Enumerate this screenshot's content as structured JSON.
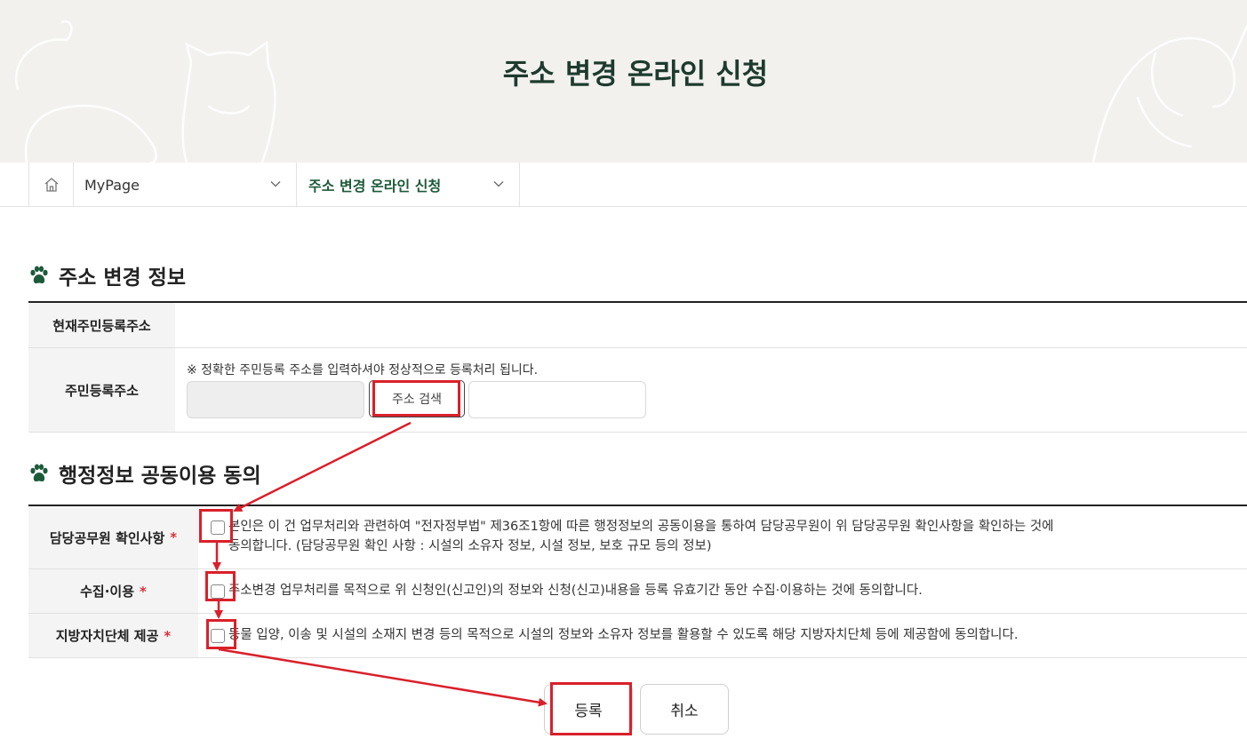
{
  "header": {
    "title": "주소 변경 온라인 신청"
  },
  "breadcrumb": {
    "home_icon": "home-icon",
    "level1": "MyPage",
    "level2": "주소 변경 온라인 신청"
  },
  "address_section": {
    "title": "주소 변경 정보",
    "current_label": "현재주민등록주소",
    "current_value": "",
    "registered_label": "주민등록주소",
    "notice": "※ 정확한 주민등록 주소를 입력하셔야 정상적으로 등록처리 됩니다.",
    "zip_value": "",
    "search_button": "주소 검색",
    "detail_value": ""
  },
  "consent_section": {
    "title": "행정정보 공동이용 동의",
    "items": [
      {
        "label": "담당공무원 확인사항",
        "required": "*",
        "text1": "본인은 이 건 업무처리와 관련하여 \"전자정부법\" 제36조1항에 따른 행정정보의 공동이용을 통하여 담당공무원이 위 담당공무원 확인사항을 확인하는 것에",
        "text2": "동의합니다. (담당공무원 확인 사항 : 시설의 소유자 정보, 시설 정보, 보호 규모 등의 정보)",
        "checked": false
      },
      {
        "label": "수집·이용",
        "required": "*",
        "text1": "주소변경 업무처리를 목적으로 위 신청인(신고인)의 정보와 신청(신고)내용을 등록 유효기간 동안 수집·이용하는 것에 동의합니다.",
        "checked": false
      },
      {
        "label": "지방자치단체 제공",
        "required": "*",
        "text1": "동물 입양, 이송 및 시설의 소재지 변경 등의 목적으로 시설의 정보와 소유자 정보를 활용할 수 있도록 해당 지방자치단체 등에 제공함에 동의합니다.",
        "checked": false
      }
    ]
  },
  "actions": {
    "submit": "등록",
    "cancel": "취소"
  },
  "colors": {
    "accent_green": "#1d5a3a",
    "annotation_red": "#d9202a",
    "required_red": "#d9313b"
  }
}
